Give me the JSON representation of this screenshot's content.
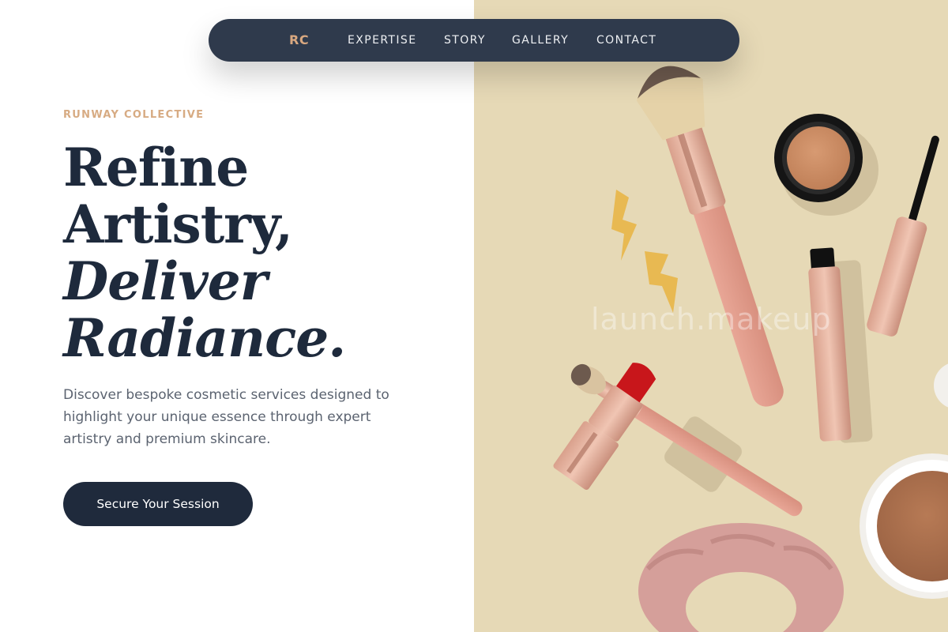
{
  "nav": {
    "logo": "RC",
    "links": [
      "EXPERTISE",
      "STORY",
      "GALLERY",
      "CONTACT"
    ]
  },
  "hero": {
    "kicker": "RUNWAY COLLECTIVE",
    "headline": {
      "line1": "Refine",
      "line2": "Artistry,",
      "line3": "Deliver",
      "line4": "Radiance."
    },
    "description": "Discover bespoke cosmetic services designed to highlight your unique essence through expert artistry and premium skincare.",
    "cta_label": "Secure Your Session"
  },
  "image": {
    "watermark": "launch.makeup"
  },
  "colors": {
    "navy": "#1f2a3c",
    "nav_bg": "#2f3a4c",
    "accent": "#d7ab83",
    "image_bg": "#e6d9b6"
  }
}
